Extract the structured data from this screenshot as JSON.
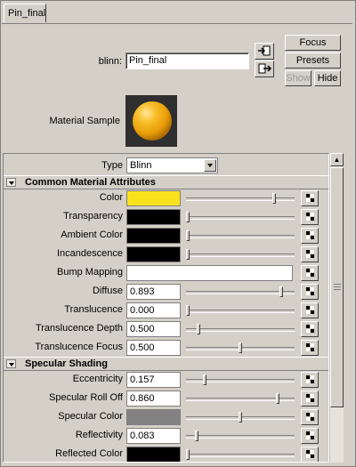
{
  "tabs": [
    {
      "label": "Pin_final"
    }
  ],
  "material": {
    "type_label": "blinn:",
    "name": "Pin_final",
    "sample_label": "Material Sample"
  },
  "buttons": {
    "focus": "Focus",
    "presets": "Presets",
    "show": "Show",
    "hide": "Hide"
  },
  "type_row": {
    "label": "Type",
    "value": "Blinn"
  },
  "sections": {
    "common": "Common Material Attributes",
    "specular": "Specular Shading"
  },
  "common_rows": [
    {
      "label": "Color",
      "color": "#f9e21c",
      "level": 0.82
    },
    {
      "label": "Transparency",
      "color": "#000000",
      "level": 0.0
    },
    {
      "label": "Ambient Color",
      "color": "#000000",
      "level": 0.0
    },
    {
      "label": "Incandescence",
      "color": "#000000",
      "level": 0.0
    },
    {
      "label": "Bump Mapping"
    },
    {
      "label": "Diffuse",
      "value": "0.893",
      "level": 0.893
    },
    {
      "label": "Translucence",
      "value": "0.000",
      "level": 0.0
    },
    {
      "label": "Translucence Depth",
      "value": "0.500",
      "level": 0.1
    },
    {
      "label": "Translucence Focus",
      "value": "0.500",
      "level": 0.5
    }
  ],
  "specular_rows": [
    {
      "label": "Eccentricity",
      "value": "0.157",
      "level": 0.157
    },
    {
      "label": "Specular Roll Off",
      "value": "0.860",
      "level": 0.86
    },
    {
      "label": "Specular Color",
      "color": "#828282",
      "level": 0.5
    },
    {
      "label": "Reflectivity",
      "value": "0.083",
      "level": 0.083
    },
    {
      "label": "Reflected Color",
      "color": "#000000",
      "level": 0.0
    }
  ]
}
